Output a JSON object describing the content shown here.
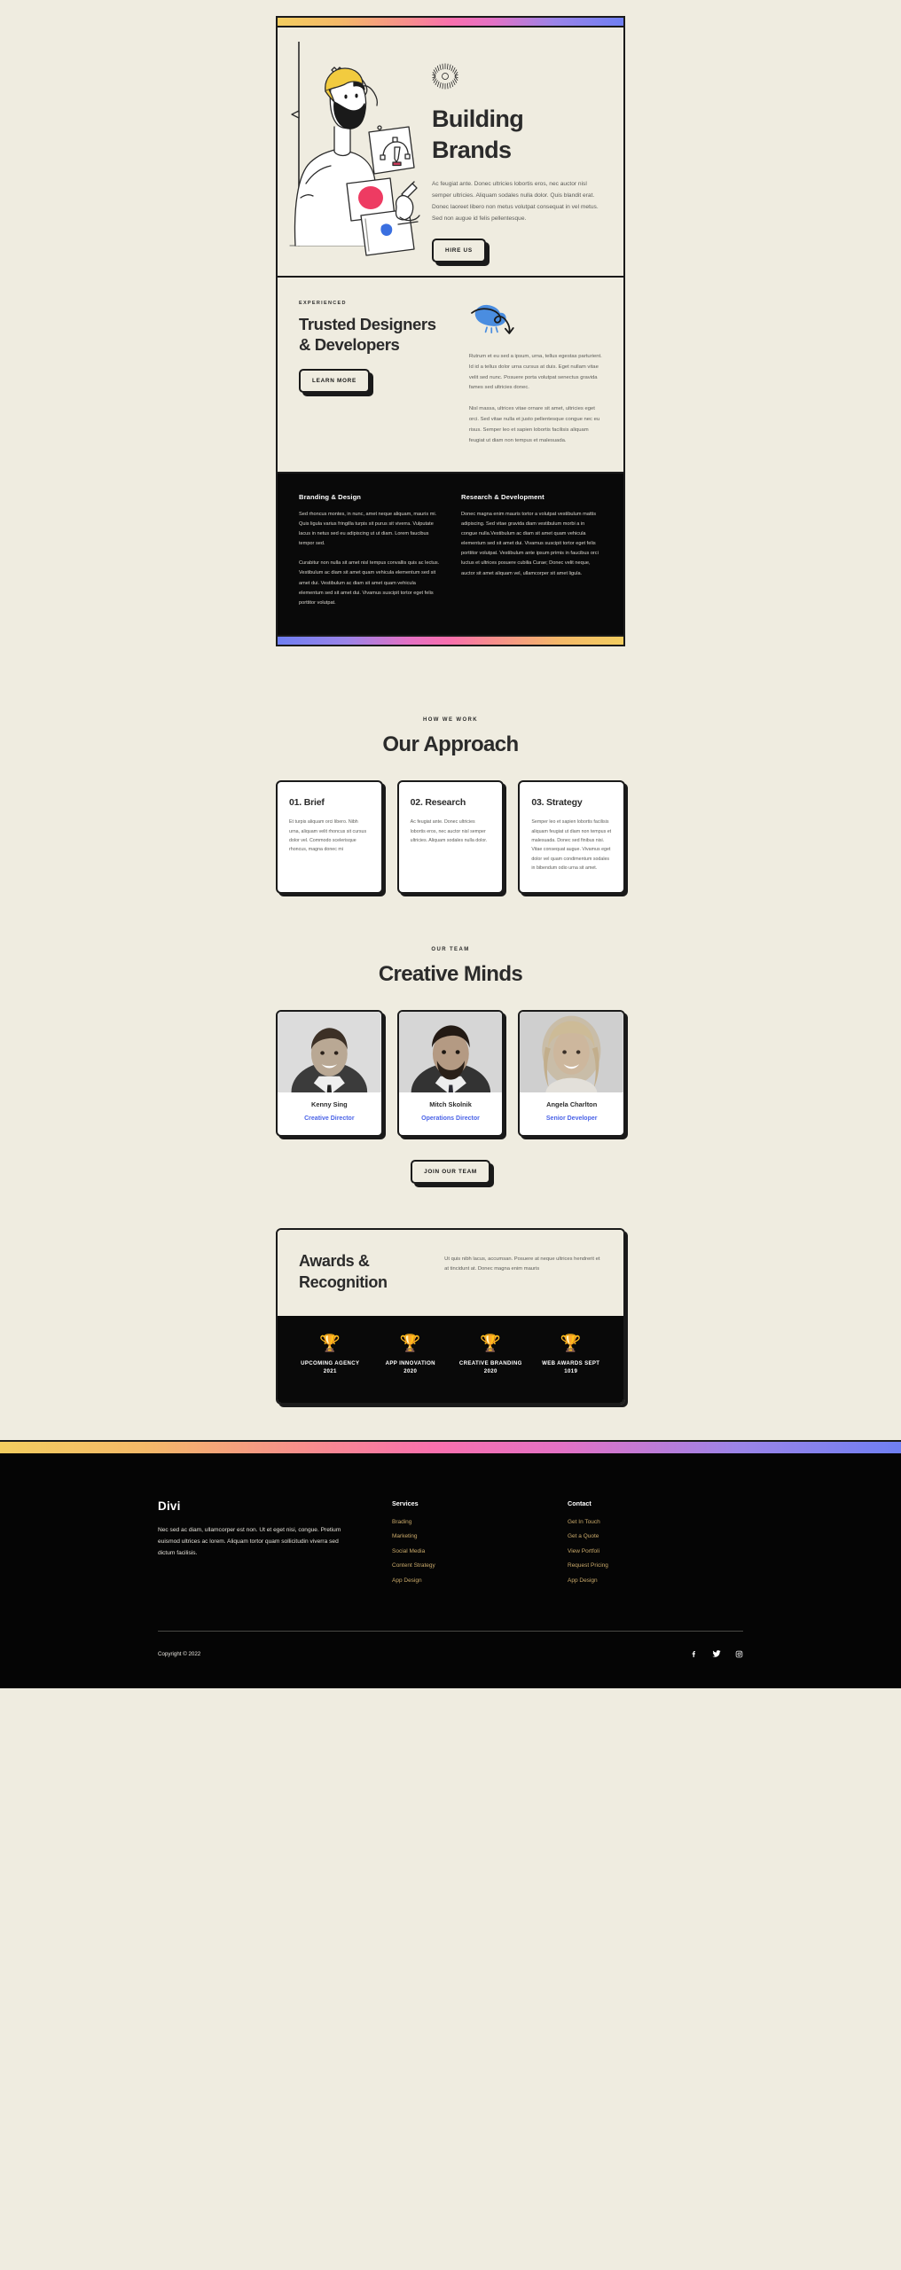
{
  "theme": {
    "bg": "#efece0",
    "ink": "#1a1a1a",
    "dark": "#090909",
    "accent_blue": "#4a63e7",
    "accent_gold": "#c9a96a",
    "trophy_gold": "#f2cd6b",
    "gradient": [
      "#f3cd5f",
      "#f78d8d",
      "#f970ad",
      "#9b84e8",
      "#6f7ff2"
    ]
  },
  "hero": {
    "badge_icon": "sunburst-icon",
    "title_line1": "Building",
    "title_line2": "Brands",
    "paragraph": "Ac feugiat ante. Donec ultricies lobortis eros, nec auctor nisl semper ultricies. Aliquam sodales nulla dolor. Quis blandit erat. Donec laoreet libero non metus volutpat consequat in vel metus. Sed non augue id felis pellentesque.",
    "cta_label": "HIRE US"
  },
  "experienced": {
    "eyebrow": "EXPERIENCED",
    "title_line1": "Trusted Designers",
    "title_line2": "& Developers",
    "cta_label": "LEARN MORE",
    "icon": "cloud-arrow-icon",
    "paragraph1": "Rutrum et eu sed a ipsum, urna, tellus egestas parturient. Id id a tellus dolor urna cursus at duis. Eget nullam vitae velit sed nunc. Posuere porta volutpat senectus gravida fames sed ultricies donec.",
    "paragraph2": "Nisl massa, ultrices vitae ornare sit amet, ultricies eget orci. Sed vitae nulla et justo pellentesque congue nec eu risus. Semper leo et sapien lobortis facilisis aliquam feugiat ut diam non tempus et malesuada."
  },
  "dark_columns": [
    {
      "heading": "Branding & Design",
      "paragraph1": "Sed rhoncus montes, in nunc, amet neque aliquam, mauris mi. Quis ligula varius fringilla turpis sit purus sit viverra. Vulputate lacus in netus sed eu adipiscing ut ut diam. Lorem faucibus tempor sed.",
      "paragraph2": "Curabitur non nulla sit amet nisl tempus convallis quis ac lectus. Vestibulum ac diam sit amet quam vehicula elementum sed sit amet dui. Vestibulum ac diam sit amet quam vehicula elementum sed sit amet dui. Vivamus suscipit tortor eget felis porttitor volutpat."
    },
    {
      "heading": "Research & Development",
      "paragraph1": "Donec magna enim mauris tortor a volutpat vestibulum mattis adipiscing. Sed vitae gravida diam vestibulum morbi a in congue nulla.Vestibulum ac diam sit amet quam vehicula elementum sed sit amet dui. Vivamus suscipit tortor eget felis porttitor volutpat. Vestibulum ante ipsum primis in faucibus orci luctus et ultrices posuere cubilia Curae; Donec velit neque, auctor sit amet aliquam vel, ullamcorper sit amet ligula.",
      "paragraph2": ""
    }
  ],
  "approach": {
    "eyebrow": "HOW WE WORK",
    "title": "Our Approach",
    "cards": [
      {
        "heading": "01. Brief",
        "body": "Et turpis aliquam orci libero. Nibh urna, aliquam velit rhoncus sit cursus dolor vel. Commodo scelerisque rhoncus, magna donec mi"
      },
      {
        "heading": "02. Research",
        "body": "Ac feugiat ante. Donec ultricies lobortis eros, nec auctor nisl semper ultricies. Aliquam sodales nulla dolor."
      },
      {
        "heading": "03. Strategy",
        "body": "Semper leo et sapien lobortis facilisis aliquam feugiat ut diam non tempus et malesuada. Donec sed finibus nisi. Vitae consequat augue. Vivamus eget dolor vel quam condimentum sodales in bibendum odio urna sit amet."
      }
    ]
  },
  "team": {
    "eyebrow": "OUR TEAM",
    "title": "Creative Minds",
    "members": [
      {
        "name": "Kenny Sing",
        "role": "Creative Director",
        "photo": "portrait-man-suit-smiling"
      },
      {
        "name": "Mitch Skolnik",
        "role": "Operations Director",
        "photo": "portrait-man-beard-suit"
      },
      {
        "name": "Angela Charlton",
        "role": "Senior Developer",
        "photo": "portrait-woman-blonde-smiling"
      }
    ],
    "cta_label": "JOIN OUR TEAM"
  },
  "awards": {
    "title_line1": "Awards &",
    "title_line2": "Recognition",
    "description": "Ut quis nibh lacus, accumsan. Posuere at neque ultrices hendrerit et at tincidunt at. Donec magna enim mauris",
    "items": [
      {
        "icon": "trophy-icon",
        "name": "UPCOMING AGENCY",
        "year": "2021"
      },
      {
        "icon": "trophy-icon",
        "name": "APP INNOVATION",
        "year": "2020"
      },
      {
        "icon": "trophy-icon",
        "name": "CREATIVE BRANDING",
        "year": "2020"
      },
      {
        "icon": "trophy-icon",
        "name": "WEB AWARDS SEPT",
        "year": "1019"
      }
    ]
  },
  "footer": {
    "logo": "Divi",
    "about": "Nec sed ac diam, ullamcorper est non. Ut et eget nisi, congue. Pretium euismod ultrices ac lorem. Aliquam tortor quam sollicitudin viverra sed dictum facilisis.",
    "services": {
      "heading": "Services",
      "links": [
        "Brading",
        "Marketing",
        "Social Media",
        "Content Strategy",
        "App Design"
      ]
    },
    "contact": {
      "heading": "Contact",
      "links": [
        "Get In Touch",
        "Get a Quote",
        "View Portfoli",
        "Request Pricing",
        "App Design"
      ]
    },
    "copyright": "Copyright © 2022",
    "socials": [
      "facebook-icon",
      "twitter-icon",
      "instagram-icon"
    ]
  }
}
